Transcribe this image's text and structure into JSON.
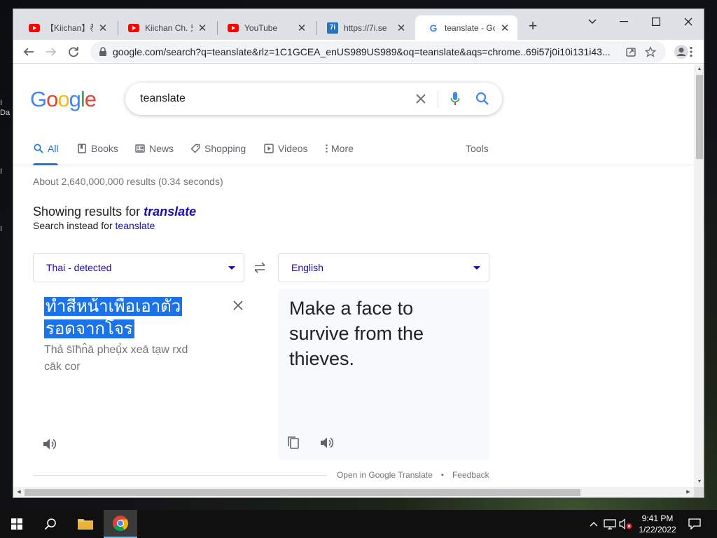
{
  "browser": {
    "tabs": [
      {
        "title": "【Kiichan】恭喜",
        "favicon": "youtube-icon",
        "active": false
      },
      {
        "title": "Kiichan Ch. 鬼",
        "favicon": "youtube-icon",
        "active": false
      },
      {
        "title": "YouTube",
        "favicon": "youtube-icon",
        "active": false
      },
      {
        "title": "https://7i.se",
        "favicon": "7i-icon",
        "active": false
      },
      {
        "title": "teanslate - Go",
        "favicon": "google-icon",
        "active": true
      }
    ],
    "url": "google.com/search?q=teanslate&rlz=1C1GCEA_enUS989US989&oq=teanslate&aqs=chrome..69i57j0i10i131i43..."
  },
  "google": {
    "logo_letters": [
      {
        "ch": "G",
        "color": "#4285F4"
      },
      {
        "ch": "o",
        "color": "#EA4335"
      },
      {
        "ch": "o",
        "color": "#FBBC05"
      },
      {
        "ch": "g",
        "color": "#4285F4"
      },
      {
        "ch": "l",
        "color": "#34A853"
      },
      {
        "ch": "e",
        "color": "#EA4335"
      }
    ],
    "query": "teanslate",
    "nav_tabs": [
      {
        "label": "All",
        "icon": "search-icon",
        "active": true
      },
      {
        "label": "Books",
        "icon": "book-icon",
        "active": false
      },
      {
        "label": "News",
        "icon": "news-icon",
        "active": false
      },
      {
        "label": "Shopping",
        "icon": "tag-icon",
        "active": false
      },
      {
        "label": "Videos",
        "icon": "play-icon",
        "active": false
      },
      {
        "label": "More",
        "icon": "more-vert-icon",
        "active": false
      }
    ],
    "tools_label": "Tools",
    "result_stats": "About 2,640,000,000 results (0.34 seconds)",
    "spell": {
      "showing_prefix": "Showing results for ",
      "corrected": "translate",
      "instead_prefix": "Search instead for ",
      "original": "teanslate"
    },
    "translate": {
      "source_language": "Thai - detected",
      "target_language": "English",
      "source_text": "ทำสีหน้าเพื่อเอาตัวรอดจากโจร",
      "transliteration": "Thả s̄īh̄n̂ā pheụ̄̀x xeā tạw rxd cāk cor",
      "target_text": "Make a face to survive from the thieves."
    },
    "footer": {
      "open_link": "Open in Google Translate",
      "separator": "•",
      "feedback": "Feedback"
    }
  },
  "taskbar": {
    "time": "9:41 PM",
    "date": "1/22/2022"
  },
  "colors": {
    "accent": "#1a73e8",
    "link": "#1a0dab",
    "highlight": "#1a73e8"
  }
}
